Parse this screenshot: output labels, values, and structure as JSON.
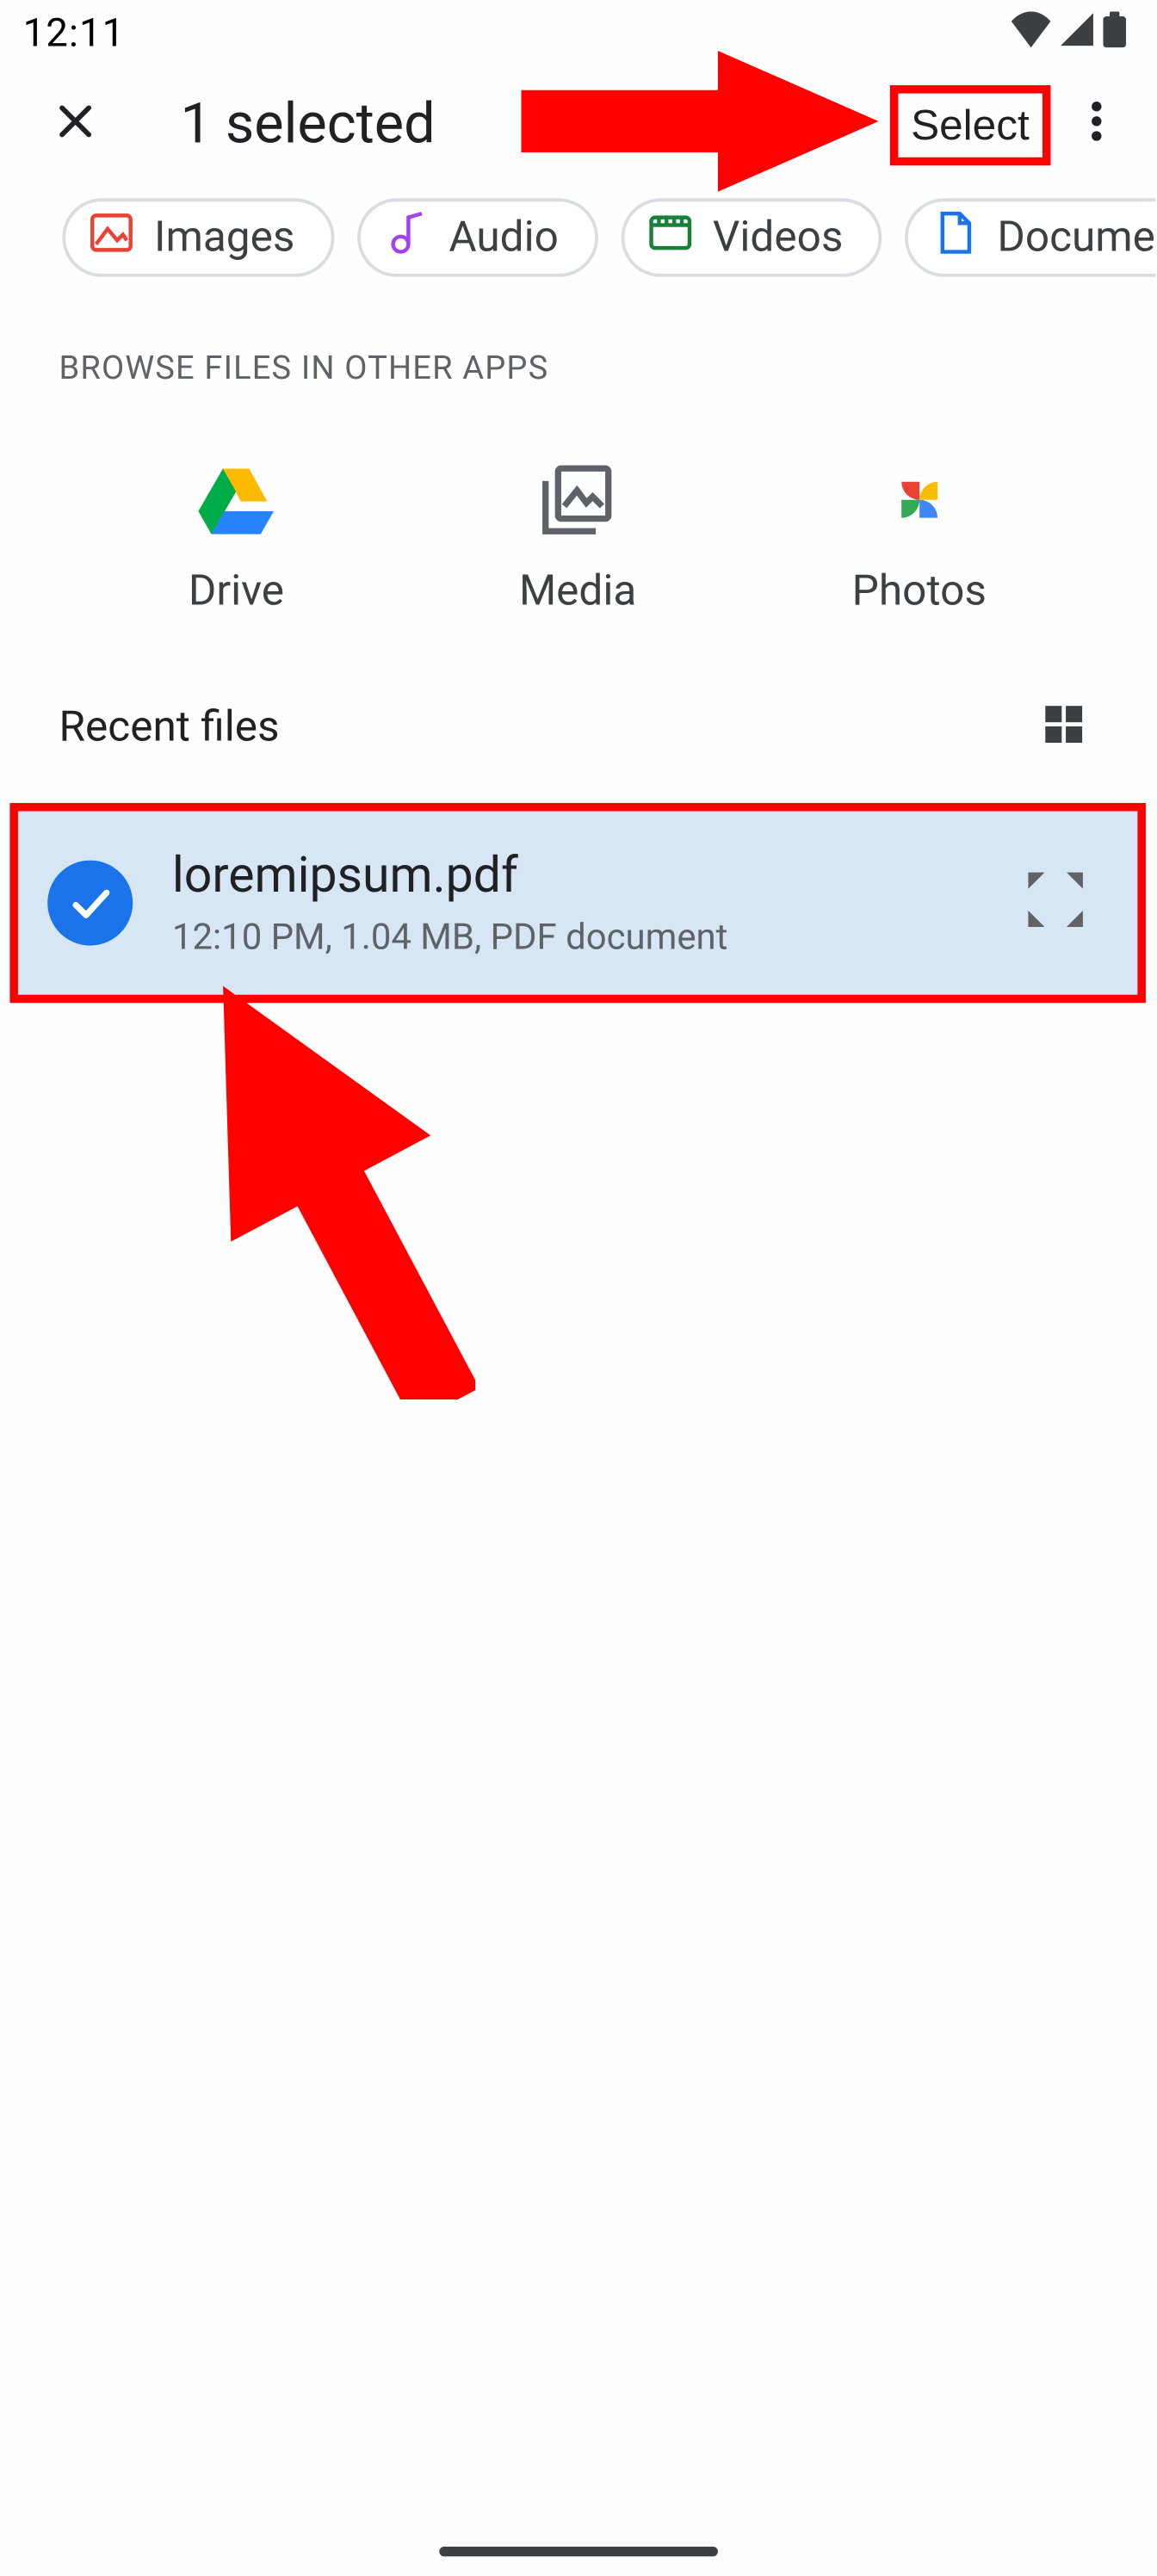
{
  "status": {
    "time": "12:11"
  },
  "toolbar": {
    "title": "1 selected",
    "select_label": "Select"
  },
  "chips": {
    "images": "Images",
    "audio": "Audio",
    "videos": "Videos",
    "documents": "Documents"
  },
  "browse_section_label": "BROWSE FILES IN OTHER APPS",
  "apps": {
    "drive": "Drive",
    "media": "Media",
    "photos": "Photos"
  },
  "recent": {
    "header": "Recent files",
    "file_name": "loremipsum.pdf",
    "file_meta": "12:10 PM, 1.04 MB, PDF document"
  }
}
